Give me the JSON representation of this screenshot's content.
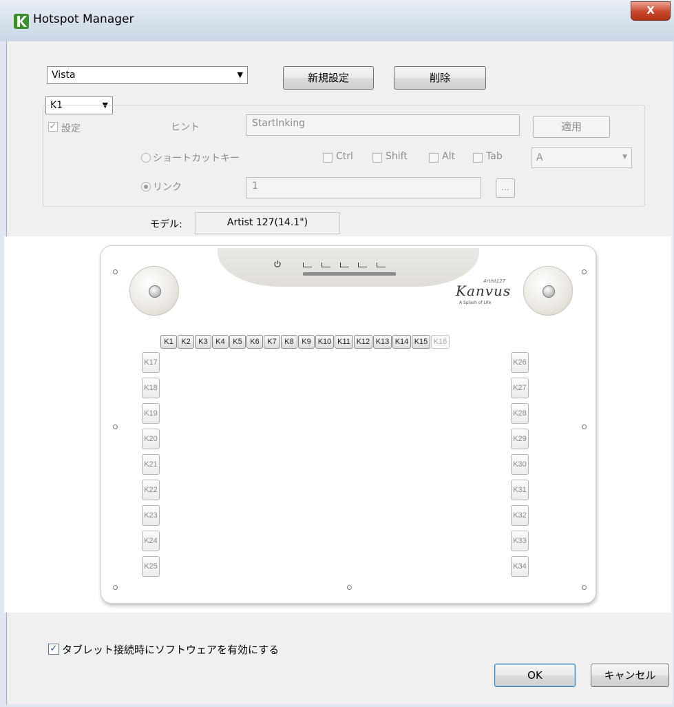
{
  "window": {
    "title": "Hotspot Manager",
    "close_glyph": "X"
  },
  "profile": {
    "selected": "Vista"
  },
  "buttons": {
    "new": "新規設定",
    "delete": "削除",
    "apply": "適用",
    "ok": "OK",
    "cancel": "キャンセル",
    "browse": "..."
  },
  "key_select": {
    "selected": "K1"
  },
  "settings": {
    "enable_label": "設定",
    "hint_label": "ヒント",
    "hint_value": "StartInking",
    "shortcut_label": "ショートカットキー",
    "modifiers": [
      "Ctrl",
      "Shift",
      "Alt",
      "Tab"
    ],
    "shortcut_key": "A",
    "link_label": "リンク",
    "link_value": "1"
  },
  "model": {
    "label": "モデル:",
    "value": "Artist 127(14.1\")"
  },
  "tablet": {
    "brand": "Kanvus",
    "brand_sub": "Artist127",
    "brand_tag": "A Splash of Life",
    "top_keys": [
      "K1",
      "K2",
      "K3",
      "K4",
      "K5",
      "K6",
      "K7",
      "K8",
      "K9",
      "K10",
      "K11",
      "K12",
      "K13",
      "K14",
      "K15",
      "K16"
    ],
    "left_keys": [
      "K17",
      "K18",
      "K19",
      "K20",
      "K21",
      "K22",
      "K23",
      "K24",
      "K25"
    ],
    "right_keys": [
      "K26",
      "K27",
      "K28",
      "K29",
      "K30",
      "K31",
      "K32",
      "K33",
      "K34"
    ]
  },
  "footer": {
    "enable_on_connect": "タブレット接続時にソフトウェアを有効にする",
    "enable_checked": true
  }
}
